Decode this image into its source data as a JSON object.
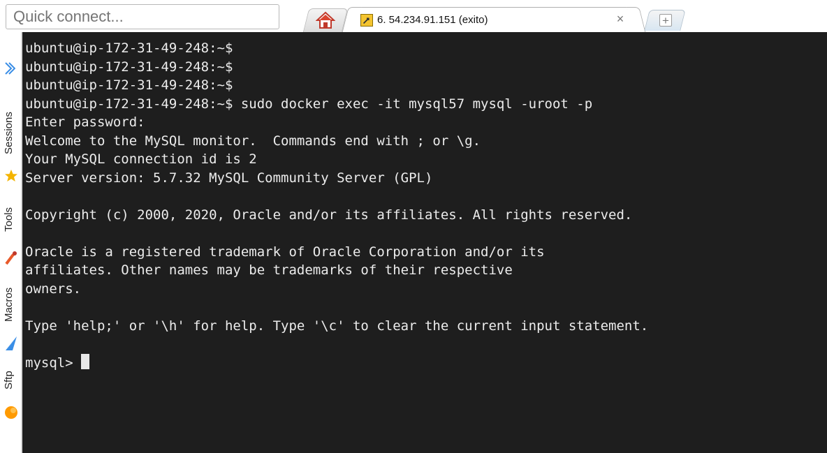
{
  "toolbar": {
    "quick_connect_placeholder": "Quick connect..."
  },
  "tabs": {
    "session_label": "6. 54.234.91.151 (exito)",
    "close_glyph": "×",
    "new_tab_glyph": "+"
  },
  "sidebar": {
    "items": [
      {
        "label": "Sessions",
        "icon": "star-icon",
        "color": "#f4b400"
      },
      {
        "label": "Tools",
        "icon": "tools-icon",
        "color": "#e85a2a"
      },
      {
        "label": "Macros",
        "icon": "macro-icon",
        "color": "#3a8ee6"
      },
      {
        "label": "Sftp",
        "icon": "sftp-icon",
        "color": "#ff9a00"
      }
    ]
  },
  "terminal": {
    "lines": [
      "ubuntu@ip-172-31-49-248:~$",
      "ubuntu@ip-172-31-49-248:~$",
      "ubuntu@ip-172-31-49-248:~$",
      "ubuntu@ip-172-31-49-248:~$ sudo docker exec -it mysql57 mysql -uroot -p",
      "Enter password:",
      "Welcome to the MySQL monitor.  Commands end with ; or \\g.",
      "Your MySQL connection id is 2",
      "Server version: 5.7.32 MySQL Community Server (GPL)",
      "",
      "Copyright (c) 2000, 2020, Oracle and/or its affiliates. All rights reserved.",
      "",
      "Oracle is a registered trademark of Oracle Corporation and/or its",
      "affiliates. Other names may be trademarks of their respective",
      "owners.",
      "",
      "Type 'help;' or '\\h' for help. Type '\\c' to clear the current input statement.",
      ""
    ],
    "prompt": "mysql> "
  },
  "colors": {
    "terminal_bg": "#1e1e1e",
    "terminal_fg": "#ececec"
  }
}
